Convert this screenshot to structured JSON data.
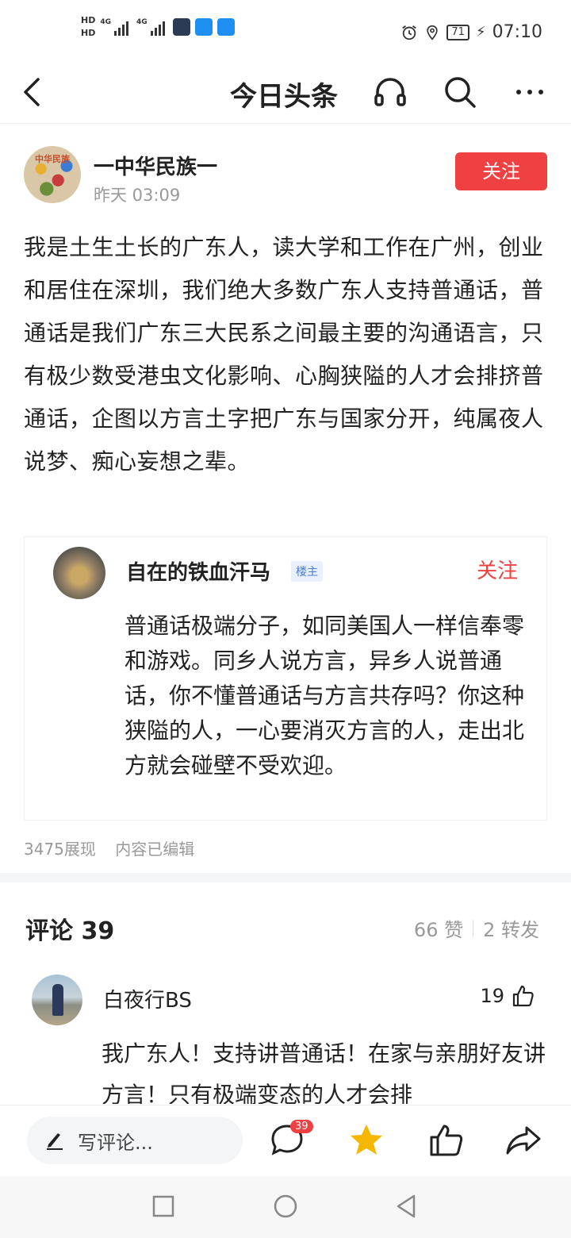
{
  "status_bar": {
    "hd1": "HD",
    "hd2": "HD",
    "net1": "4G",
    "net2": "4G",
    "battery": "71",
    "time": "07:10"
  },
  "nav": {
    "title": "今日头条",
    "icons": [
      "back-arrow-icon",
      "headphones-icon",
      "search-icon",
      "more-icon"
    ]
  },
  "author": {
    "name": "一中华民族一",
    "avatar_text": "中华民族",
    "time": "昨天  03:09",
    "follow_label": "关注"
  },
  "post": {
    "body": "我是土生土长的广东人，读大学和工作在广州，创业和居住在深圳，我们绝大多数广东人支持普通话，普通话是我们广东三大民系之间最主要的沟通语言，只有极少数受港虫文化影响、心胸狭隘的人才会排挤普通话，企图以方言土字把广东与国家分开，纯属夜人说梦、痴心妄想之辈。"
  },
  "quote": {
    "name": "自在的铁血汗马",
    "badge": "楼主",
    "follow_label": "关注",
    "text": "普通话极端分子，如同美国人一样信奉零和游戏。同乡人说方言，异乡人说普通话，你不懂普通话与方言共存吗？你这种狭隘的人，一心要消灭方言的人，走出北方就会碰壁不受欢迎。"
  },
  "meta": {
    "views": "3475展现",
    "edited": "内容已编辑"
  },
  "comments_header": {
    "title": "评论 39",
    "likes": "66 赞",
    "shares": "2 转发"
  },
  "comment": {
    "name": "白夜行BS",
    "likes": "19",
    "text": "我广东人！支持讲普通话！在家与亲朋好友讲方言！只有极端变态的人才会排"
  },
  "actionbar": {
    "input_placeholder": "写评论...",
    "comment_count": "39"
  },
  "colors": {
    "accent_red": "#f04142",
    "star_yellow": "#f5b700",
    "badge_blue": "#4a7bd5"
  }
}
